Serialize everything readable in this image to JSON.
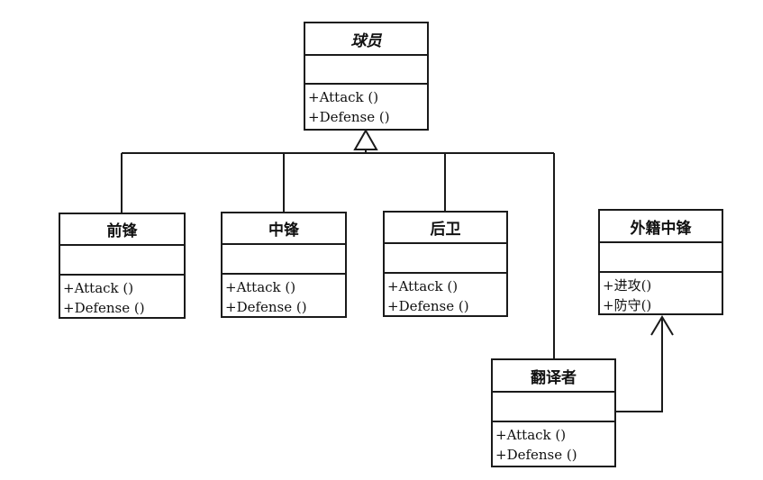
{
  "classes": {
    "player": {
      "name": "球员",
      "ops": [
        "+Attack ()",
        "+Defense ()"
      ]
    },
    "forward": {
      "name": "前锋",
      "ops": [
        "+Attack ()",
        "+Defense ()"
      ]
    },
    "center": {
      "name": "中锋",
      "ops": [
        "+Attack ()",
        "+Defense ()"
      ]
    },
    "guard": {
      "name": "后卫",
      "ops": [
        "+Attack ()",
        "+Defense ()"
      ]
    },
    "foreign_center": {
      "name": "外籍中锋",
      "ops": [
        "+进攻()",
        "+防守()"
      ]
    },
    "translator": {
      "name": "翻译者",
      "ops": [
        "+Attack ()",
        "+Defense ()"
      ]
    }
  }
}
